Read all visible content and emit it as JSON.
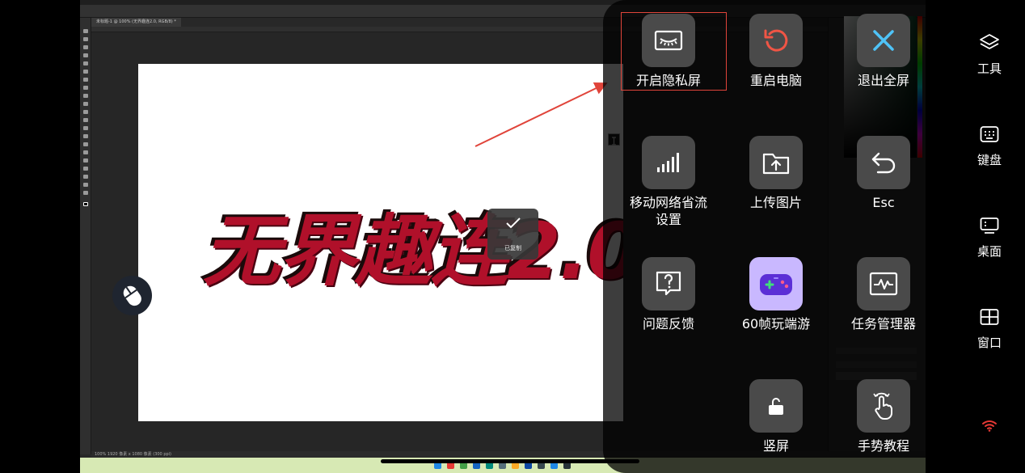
{
  "photoshop": {
    "doc_tab": "未标题-1 @ 100% (无界趣连2.0, RGB/8) *",
    "statusbar": "100%   1920 像素 x 1080 像素 (300 ppi)",
    "canvas_text": "无界趣连2.0"
  },
  "toast": {
    "label": "已复制"
  },
  "controls": [
    {
      "id": "privacy-screen",
      "label": "开启隐私屏",
      "icon": "privacy-eye-icon"
    },
    {
      "id": "restart",
      "label": "重启电脑",
      "icon": "restart-icon"
    },
    {
      "id": "exit-fullscreen",
      "label": "退出全屏",
      "icon": "close-icon"
    },
    {
      "id": "mobile-data-saver",
      "label": "移动网络省流\n设置",
      "icon": "signal-bars-icon"
    },
    {
      "id": "upload-image",
      "label": "上传图片",
      "icon": "upload-folder-icon"
    },
    {
      "id": "esc",
      "label": "Esc",
      "icon": "return-arrow-icon"
    },
    {
      "id": "feedback",
      "label": "问题反馈",
      "icon": "question-icon"
    },
    {
      "id": "fps60",
      "label": "60帧玩端游",
      "icon": "gamepad-icon"
    },
    {
      "id": "task-manager",
      "label": "任务管理器",
      "icon": "activity-monitor-icon"
    },
    {
      "id": "portrait",
      "label": "竖屏",
      "icon": "rotate-lock-icon"
    },
    {
      "id": "gesture-tutorial",
      "label": "手势教程",
      "icon": "gesture-hand-icon"
    }
  ],
  "sidebar": [
    {
      "id": "tools",
      "label": "工具",
      "icon": "layers-icon"
    },
    {
      "id": "keyboard",
      "label": "键盘",
      "icon": "keyboard-icon"
    },
    {
      "id": "desktop",
      "label": "桌面",
      "icon": "monitor-icon"
    },
    {
      "id": "window",
      "label": "窗口",
      "icon": "window-grid-icon"
    }
  ],
  "colors": {
    "accent_red": "#e0443a",
    "wifi": "#e53935",
    "close_x": "#4fc3f7",
    "restart": "#f05545",
    "gamepad_bg": "#c9b8ff"
  }
}
